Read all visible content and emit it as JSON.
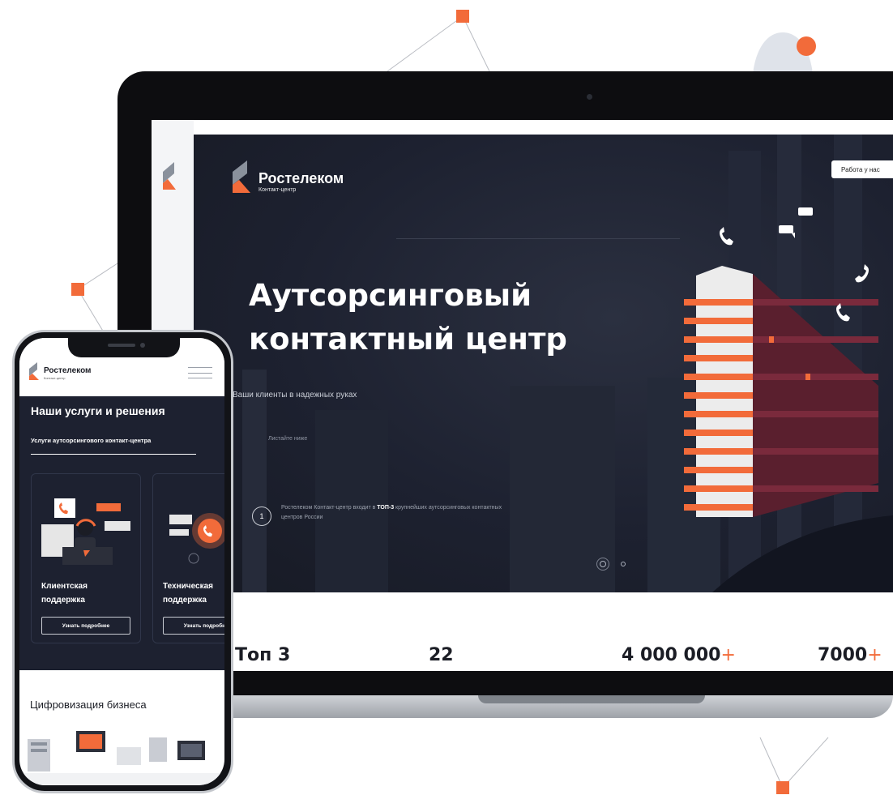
{
  "site": {
    "brand_name": "Ростелеком",
    "brand_sub": "Контакт-центр",
    "job_button": "Работа у нас",
    "hero_title_line1": "Аутсорсинговый",
    "hero_title_line2": "контактный центр",
    "hero_subtitle": "Ваши клиенты в надежных руках",
    "scroll_hint": "Листайте ниже",
    "fact_number": "1",
    "fact_text_before": "Ростелеком Контакт-центр входит в ",
    "fact_text_bold": "ТОП-3",
    "fact_text_after": " крупнейших аутсорсинговых контактных центров России",
    "stats": [
      {
        "value": "Топ 3",
        "plus": ""
      },
      {
        "value": "22",
        "plus": ""
      },
      {
        "value": "4 000 000",
        "plus": "+"
      },
      {
        "value": "7000",
        "plus": "+"
      }
    ]
  },
  "mobile": {
    "brand_name": "Ростелеком",
    "brand_sub": "Контакт-центр",
    "services_title": "Наши услуги и решения",
    "active_tab": "Услуги аутсорсингового контакт-центра",
    "cards": [
      {
        "title_line1": "Клиентская",
        "title_line2": "поддержка",
        "button": "Узнать подробнее"
      },
      {
        "title_line1": "Техническая",
        "title_line2": "поддержка",
        "button": "Узнать подробнее"
      }
    ],
    "digital_title": "Цифровизация бизнеса"
  },
  "colors": {
    "accent": "#f26b3a",
    "dark_bg": "#1d2130",
    "logo_gray": "#8a919c"
  },
  "icons": [
    "bell-icon",
    "phone-icon",
    "chat-icon",
    "menu-icon",
    "logo-icon"
  ]
}
